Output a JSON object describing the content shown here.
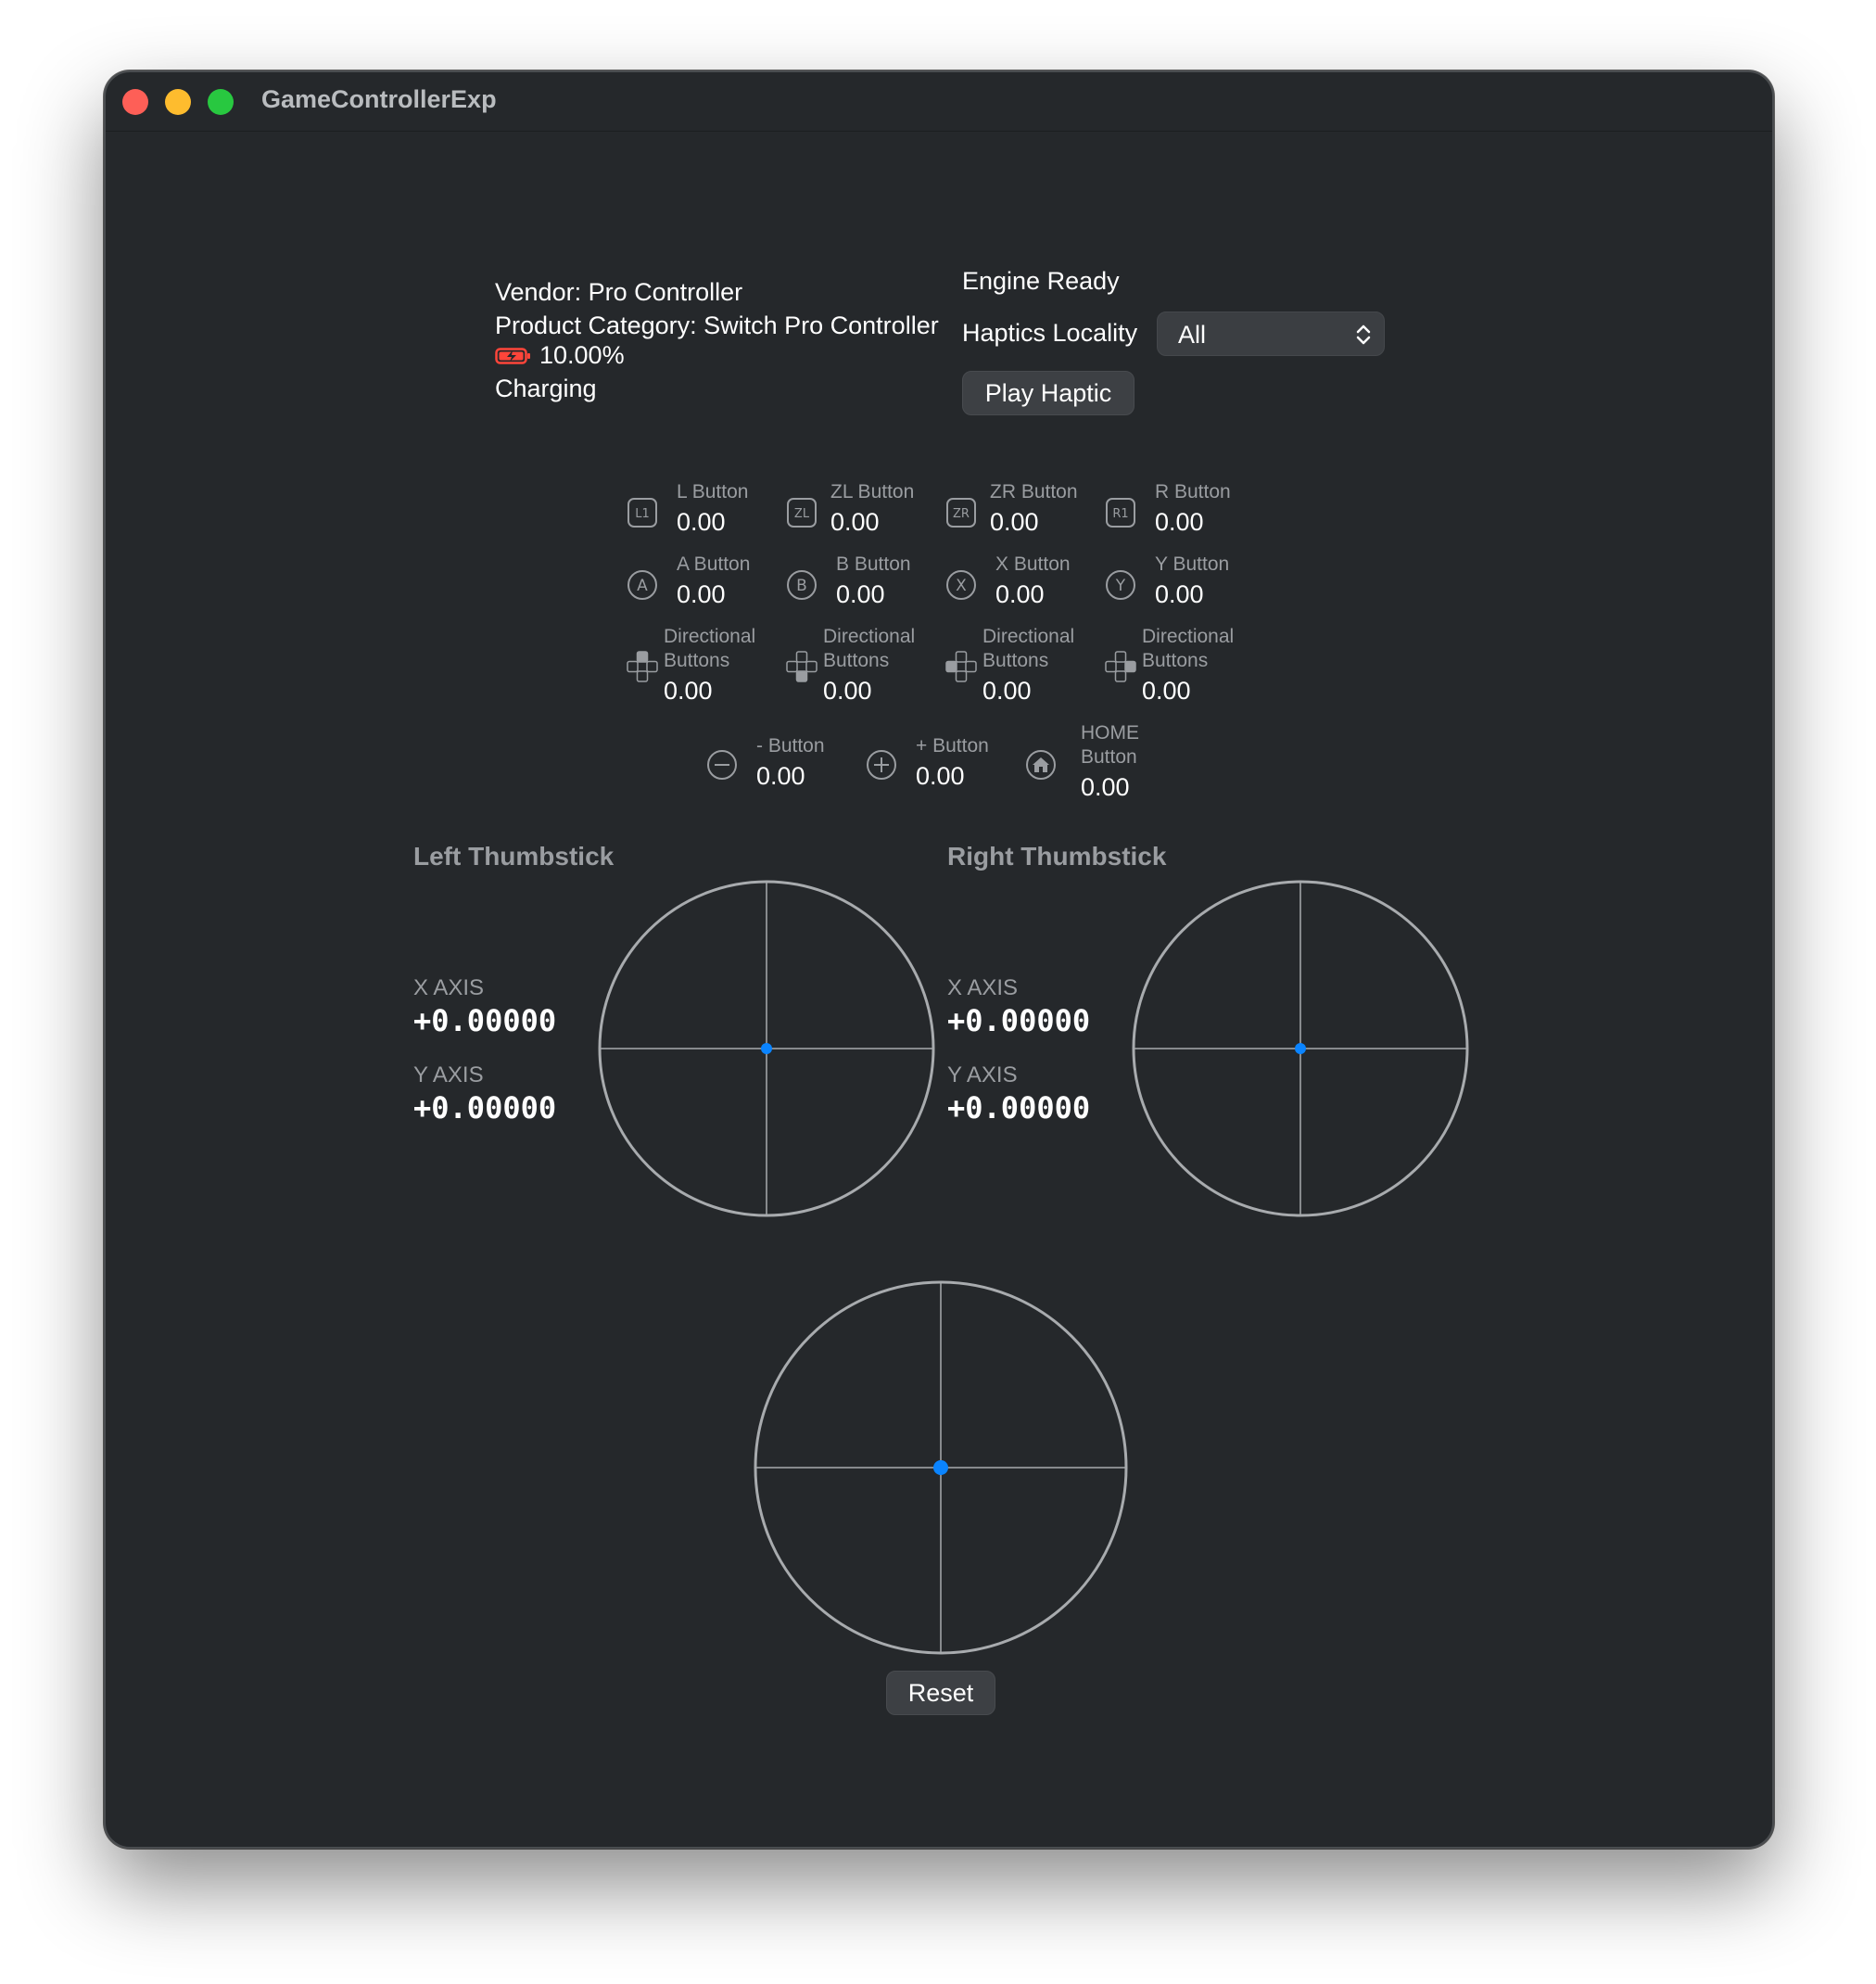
{
  "window": {
    "title": "GameControllerExp"
  },
  "info": {
    "vendor": "Vendor: Pro Controller",
    "category": "Product Category: Switch Pro Controller",
    "battery": "10.00%",
    "charging": "Charging"
  },
  "haptics": {
    "status": "Engine Ready",
    "locality_label": "Haptics Locality",
    "locality_value": "All",
    "play_label": "Play Haptic"
  },
  "controls": [
    {
      "label": "L Button",
      "value": "0.00",
      "icon": "l1-icon"
    },
    {
      "label": "ZL Button",
      "value": "0.00",
      "icon": "zl-icon"
    },
    {
      "label": "ZR Button",
      "value": "0.00",
      "icon": "zr-icon"
    },
    {
      "label": "R Button",
      "value": "0.00",
      "icon": "r1-icon"
    },
    {
      "label": "A Button",
      "value": "0.00",
      "icon": "a-button-icon"
    },
    {
      "label": "B Button",
      "value": "0.00",
      "icon": "b-button-icon"
    },
    {
      "label": "X Button",
      "value": "0.00",
      "icon": "x-button-icon"
    },
    {
      "label": "Y Button",
      "value": "0.00",
      "icon": "y-button-icon"
    },
    {
      "label": "Directional Buttons",
      "value": "0.00",
      "icon": "dpad-up-icon"
    },
    {
      "label": "Directional Buttons",
      "value": "0.00",
      "icon": "dpad-down-icon"
    },
    {
      "label": "Directional Buttons",
      "value": "0.00",
      "icon": "dpad-left-icon"
    },
    {
      "label": "Directional Buttons",
      "value": "0.00",
      "icon": "dpad-right-icon"
    },
    {
      "label": "- Button",
      "value": "0.00",
      "icon": "minus-icon"
    },
    {
      "label": "+ Button",
      "value": "0.00",
      "icon": "plus-icon"
    },
    {
      "label": "HOME Button",
      "value": "0.00",
      "icon": "home-icon"
    }
  ],
  "left_stick": {
    "title": "Left Thumbstick",
    "x_label": "X AXIS",
    "x_value": "+0.00000",
    "y_label": "Y AXIS",
    "y_value": "+0.00000"
  },
  "right_stick": {
    "title": "Right Thumbstick",
    "x_label": "X AXIS",
    "x_value": "+0.00000",
    "y_label": "Y AXIS",
    "y_value": "+0.00000"
  },
  "reset_label": "Reset",
  "colors": {
    "accent": "#0a84ff",
    "battery": "#ff453a",
    "background": "#25282b"
  }
}
